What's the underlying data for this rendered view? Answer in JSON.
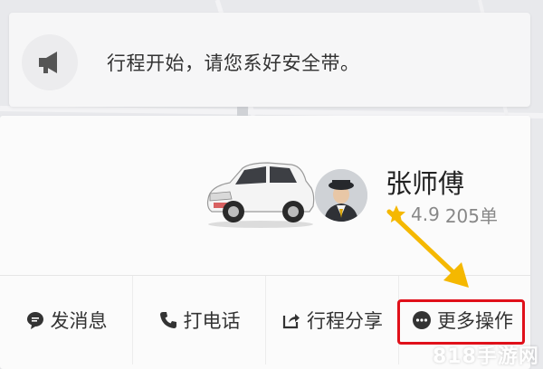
{
  "notice": {
    "icon": "megaphone-icon",
    "text": "行程开始，请您系好安全带。"
  },
  "driver": {
    "name": "张师傅",
    "rating": "4.9",
    "orders": "205单",
    "star_color": "#f5b800",
    "car_icon": "white-suv-image",
    "avatar_icon": "driver-avatar"
  },
  "actions": [
    {
      "label": "发消息",
      "icon": "message-icon"
    },
    {
      "label": "打电话",
      "icon": "phone-icon"
    },
    {
      "label": "行程分享",
      "icon": "share-icon"
    },
    {
      "label": "更多操作",
      "icon": "more-dots-icon"
    }
  ],
  "annotation": {
    "highlight_color": "#e0101a",
    "arrow_color": "#f5b800"
  },
  "watermark": "818手游网"
}
